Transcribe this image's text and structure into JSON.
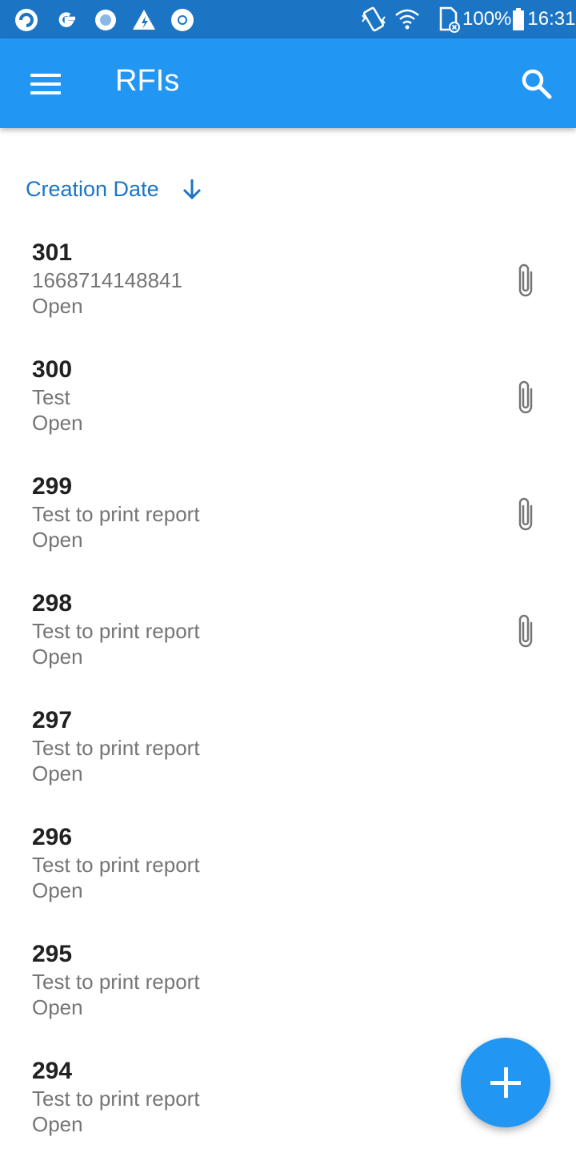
{
  "status_bar": {
    "left_icons": [
      "app-logo-icon",
      "google-icon",
      "circle-app-icon",
      "drive-icon",
      "chrome-icon"
    ],
    "right_icons": [
      "vibrate-icon",
      "wifi-icon",
      "sd-card-icon",
      "battery-icon"
    ],
    "battery": "100%",
    "time": "16:31"
  },
  "app_bar": {
    "title": "RFIs",
    "menu_icon": "menu-icon",
    "search_icon": "search-icon",
    "color": "#2196f3"
  },
  "sort": {
    "label": "Creation Date",
    "direction_icon": "arrow-down-icon"
  },
  "items": [
    {
      "number": "301",
      "subject": "1668714148841",
      "status": "Open",
      "has_attachment": true
    },
    {
      "number": "300",
      "subject": "Test",
      "status": "Open",
      "has_attachment": true
    },
    {
      "number": "299",
      "subject": "Test to print report",
      "status": "Open",
      "has_attachment": true
    },
    {
      "number": "298",
      "subject": "Test to print report",
      "status": "Open",
      "has_attachment": true
    },
    {
      "number": "297",
      "subject": "Test to print report",
      "status": "Open",
      "has_attachment": false
    },
    {
      "number": "296",
      "subject": "Test to print report",
      "status": "Open",
      "has_attachment": false
    },
    {
      "number": "295",
      "subject": "Test to print report",
      "status": "Open",
      "has_attachment": false
    },
    {
      "number": "294",
      "subject": "Test to print report",
      "status": "Open",
      "has_attachment": false
    }
  ],
  "fab": {
    "icon": "plus-icon"
  }
}
